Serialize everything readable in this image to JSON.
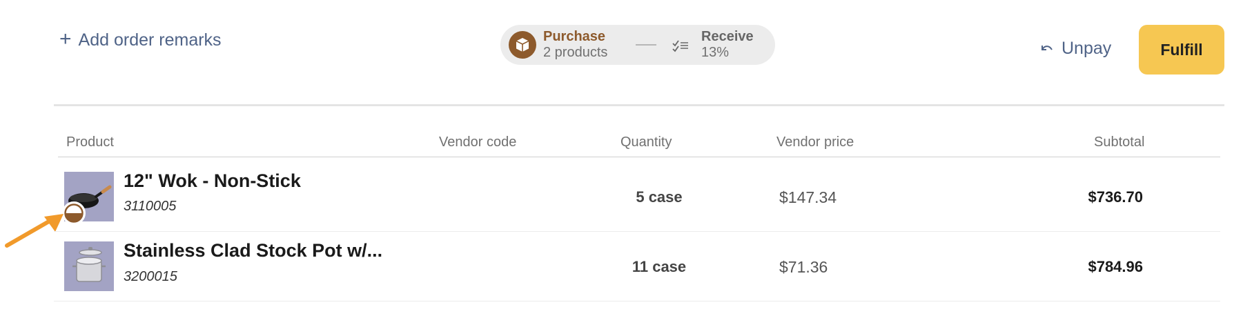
{
  "header": {
    "add_remarks_label": "Add order remarks",
    "steps": [
      {
        "title": "Purchase",
        "subtitle": "2 products",
        "icon": "box-icon",
        "color": "#8d5a2c"
      },
      {
        "title": "Receive",
        "subtitle": "13%",
        "icon": "checklist-icon"
      }
    ],
    "unpay_label": "Unpay",
    "fulfill_label": "Fulfill"
  },
  "table": {
    "columns": [
      "Product",
      "Vendor code",
      "Quantity",
      "Vendor price",
      "Subtotal"
    ],
    "rows": [
      {
        "name": "12\" Wok - Non-Stick",
        "sku": "3110005",
        "vendor_code": "",
        "quantity": "5 case",
        "vendor_price": "$147.34",
        "subtotal": "$736.70",
        "image": "wok-image",
        "badge": "half-filled-status-icon"
      },
      {
        "name": "Stainless Clad Stock Pot w/...",
        "sku": "3200015",
        "vendor_code": "",
        "quantity": "11 case",
        "vendor_price": "$71.36",
        "subtotal": "$784.96",
        "image": "stock-pot-image"
      }
    ]
  },
  "colors": {
    "accent": "#f6c752",
    "brand_brown": "#8d5a2c",
    "link": "#4f6387",
    "annotation_arrow": "#f19a2b"
  }
}
